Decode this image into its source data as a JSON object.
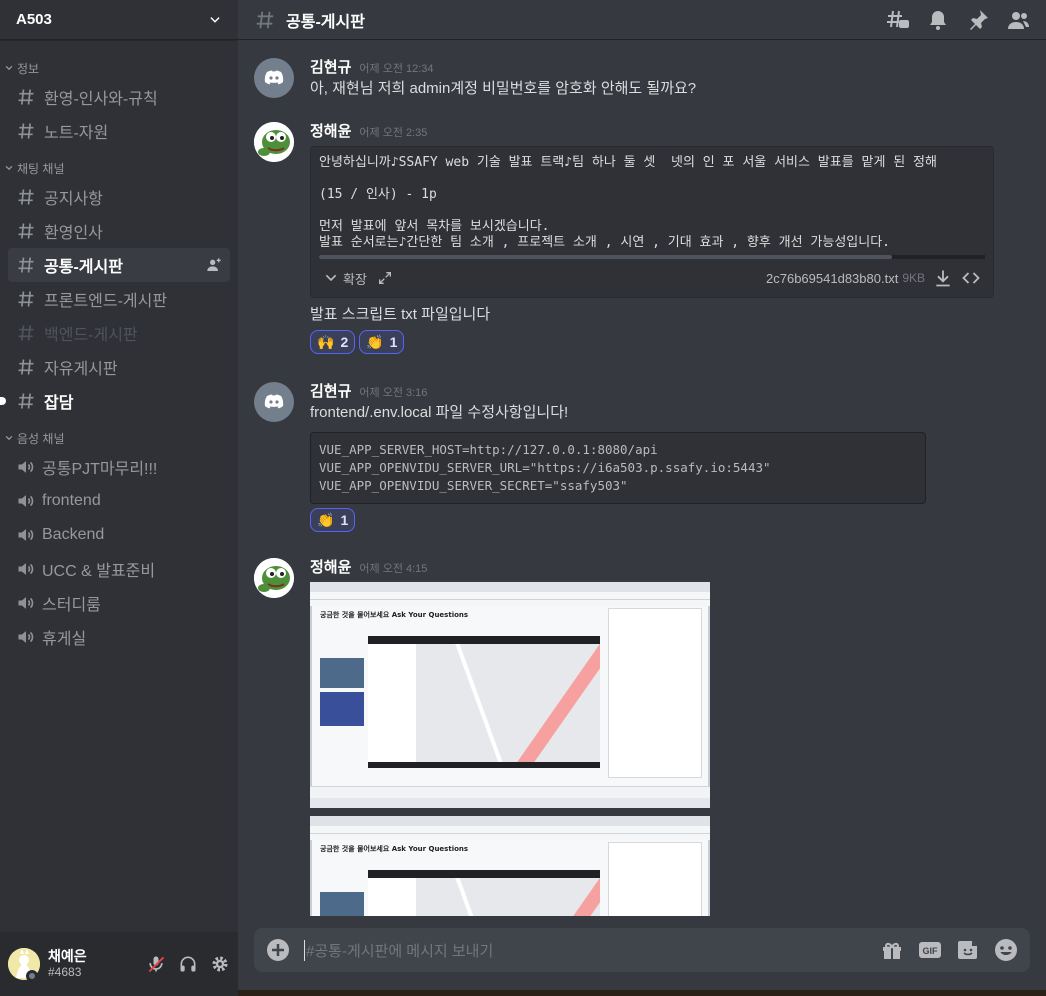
{
  "server": {
    "name": "A503"
  },
  "categories": [
    {
      "label": "정보",
      "channels": [
        {
          "label": "환영-인사와-규칙",
          "type": "text",
          "state": "normal"
        },
        {
          "label": "노트-자원",
          "type": "text",
          "state": "normal"
        }
      ]
    },
    {
      "label": "채팅 채널",
      "channels": [
        {
          "label": "공지사항",
          "type": "text",
          "state": "normal"
        },
        {
          "label": "환영인사",
          "type": "text",
          "state": "normal"
        },
        {
          "label": "공통-게시판",
          "type": "text",
          "state": "active"
        },
        {
          "label": "프론트엔드-게시판",
          "type": "text",
          "state": "normal"
        },
        {
          "label": "백엔드-게시판",
          "type": "text",
          "state": "muted"
        },
        {
          "label": "자유게시판",
          "type": "text",
          "state": "normal"
        },
        {
          "label": "잡담",
          "type": "text",
          "state": "unread"
        }
      ]
    },
    {
      "label": "음성 채널",
      "channels": [
        {
          "label": "공통PJT마무리!!!",
          "type": "voice",
          "state": "normal"
        },
        {
          "label": "frontend",
          "type": "voice",
          "state": "normal"
        },
        {
          "label": "Backend",
          "type": "voice",
          "state": "normal"
        },
        {
          "label": "UCC & 발표준비",
          "type": "voice",
          "state": "normal"
        },
        {
          "label": "스터디룸",
          "type": "voice",
          "state": "normal"
        },
        {
          "label": "휴게실",
          "type": "voice",
          "state": "normal"
        }
      ]
    }
  ],
  "user": {
    "name": "채예은",
    "tag": "#4683"
  },
  "topbar": {
    "channel": "공통-게시판",
    "icons": [
      "threads-icon",
      "bell-icon",
      "pin-icon",
      "members-icon"
    ]
  },
  "messages": [
    {
      "author": "김현규",
      "time": "어제 오전 12:34",
      "avatar": "discord",
      "text": "아, 재현님 저희 admin계정 비밀번호를 암호화 안해도 될까요?"
    },
    {
      "author": "정해윤",
      "time": "어제 오전 2:35",
      "avatar": "pepe",
      "attachment": {
        "preview": "안녕하십니까♪SSAFY web 기술 발표 트랙♪팀 하나 둘 셋  넷의 인 포 서울 서비스 발표를 맡게 된 정해\n\n(15 / 인사) - 1p\n\n먼저 발표에 앞서 목차를 보시겠습니다.\n발표 순서로는♪간단한 팀 소개 , 프로젝트 소개 , 시연 , 기대 효과 , 향후 개선 가능성입니다.",
        "expand_label": "확장",
        "filename": "2c76b69541d83b80.txt",
        "size": "9KB"
      },
      "text": "발표 스크립트 txt 파일입니다",
      "reactions": [
        {
          "emoji": "🙌",
          "count": "2"
        },
        {
          "emoji": "👏",
          "count": "1"
        }
      ]
    },
    {
      "author": "김현규",
      "time": "어제 오전 3:16",
      "avatar": "discord",
      "text": "frontend/.env.local 파일 수정사항입니다!",
      "code": "VUE_APP_SERVER_HOST=http://127.0.0.1:8080/api\nVUE_APP_OPENVIDU_SERVER_URL=\"https://i6a503.p.ssafy.io:5443\"\nVUE_APP_OPENVIDU_SERVER_SECRET=\"ssafy503\"",
      "reactions": [
        {
          "emoji": "👏",
          "count": "1"
        }
      ]
    },
    {
      "author": "정해윤",
      "time": "어제 오전 4:15",
      "avatar": "pepe",
      "screenshot_title": "궁금한 것을 물어보세요 Ask Your Questions"
    }
  ],
  "composer": {
    "placeholder": "#공통-게시판에 메시지 보내기"
  },
  "colors": {
    "sidebar": "#2f3136",
    "main": "#36393f",
    "accent": "#5865f2",
    "user_panel": "#292b2f"
  }
}
